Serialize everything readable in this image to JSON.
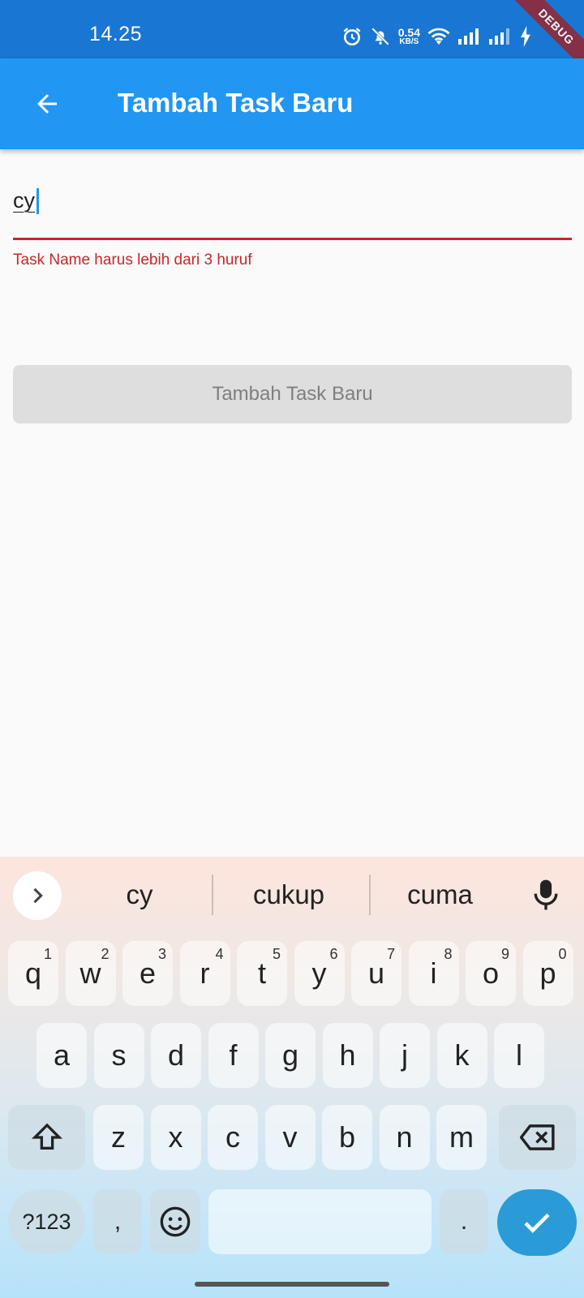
{
  "status_bar": {
    "time": "14.25",
    "net_speed_value": "0.54",
    "net_speed_unit": "KB/S",
    "icons": [
      "alarm-icon",
      "mute-icon",
      "wifi-icon",
      "signal-icon",
      "signal-icon",
      "charging-icon"
    ]
  },
  "debug_banner": "DEBUG",
  "app_bar": {
    "title": "Tambah Task Baru",
    "back_icon": "arrow-back-icon"
  },
  "form": {
    "task_name_value": "cy",
    "error_text": "Task Name harus lebih dari 3 huruf",
    "submit_label": "Tambah Task Baru"
  },
  "keyboard": {
    "suggestions": [
      "cy",
      "cukup",
      "cuma"
    ],
    "row1": [
      {
        "letter": "q",
        "num": "1"
      },
      {
        "letter": "w",
        "num": "2"
      },
      {
        "letter": "e",
        "num": "3"
      },
      {
        "letter": "r",
        "num": "4"
      },
      {
        "letter": "t",
        "num": "5"
      },
      {
        "letter": "y",
        "num": "6"
      },
      {
        "letter": "u",
        "num": "7"
      },
      {
        "letter": "i",
        "num": "8"
      },
      {
        "letter": "o",
        "num": "9"
      },
      {
        "letter": "p",
        "num": "0"
      }
    ],
    "row2": [
      "a",
      "s",
      "d",
      "f",
      "g",
      "h",
      "j",
      "k",
      "l"
    ],
    "row3": [
      "z",
      "x",
      "c",
      "v",
      "b",
      "n",
      "m"
    ],
    "symbols_label": "?123",
    "comma_label": ",",
    "period_label": ".",
    "emoji_icon": "emoji-icon",
    "shift_icon": "shift-icon",
    "backspace_icon": "backspace-icon",
    "enter_icon": "check-icon",
    "mic_icon": "mic-icon"
  },
  "colors": {
    "status_bar": "#1976d2",
    "app_bar": "#2196f3",
    "error": "#c62828",
    "enter_key": "#2a9bd6"
  }
}
